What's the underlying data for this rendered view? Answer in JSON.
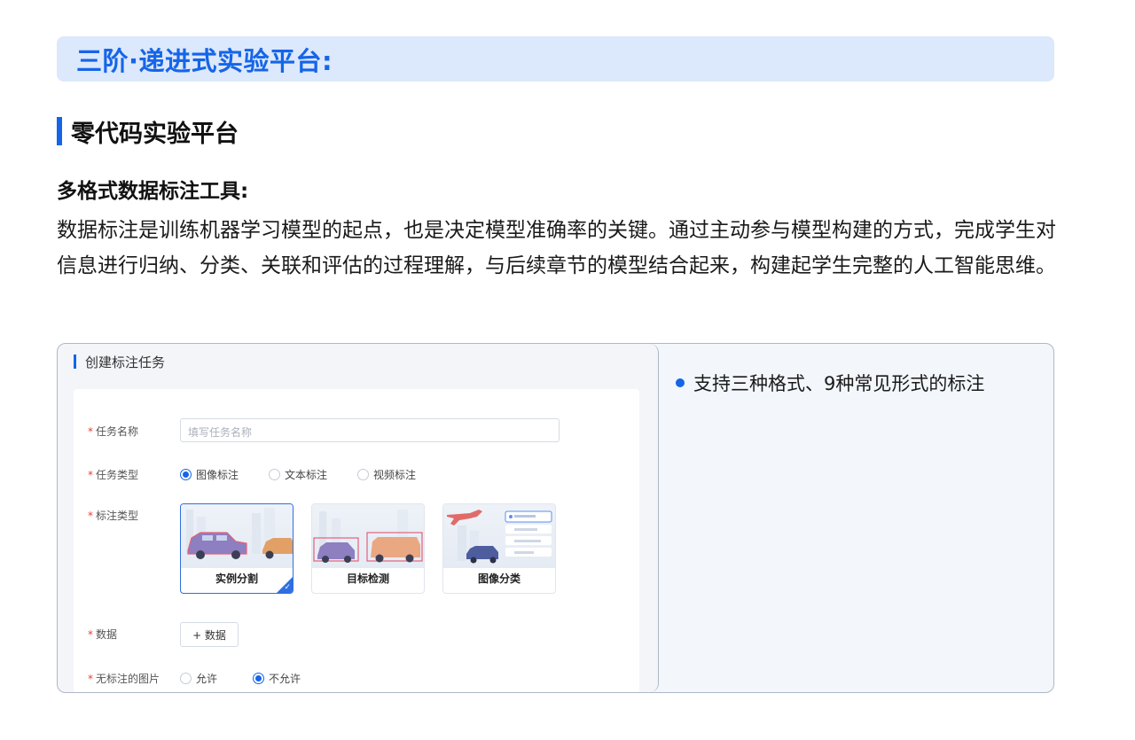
{
  "banner": {
    "title": "三阶·递进式实验平台:"
  },
  "section": {
    "title": "零代码实验平台"
  },
  "feature": {
    "title": "多格式数据标注工具:",
    "description": "数据标注是训练机器学习模型的起点，也是决定模型准确率的关键。通过主动参与模型构建的方式，完成学生对信息进行归纳、分类、关联和评估的过程理解，与后续章节的模型结合起来，构建起学生完整的人工智能思维。"
  },
  "form": {
    "heading": "创建标注任务",
    "required_mark": "*",
    "task_name": {
      "label": "任务名称",
      "placeholder": "填写任务名称"
    },
    "task_type": {
      "label": "任务类型",
      "options": [
        {
          "label": "图像标注",
          "selected": true
        },
        {
          "label": "文本标注",
          "selected": false
        },
        {
          "label": "视频标注",
          "selected": false
        }
      ]
    },
    "annotation_type": {
      "label": "标注类型",
      "cards": [
        {
          "label": "实例分割",
          "selected": true
        },
        {
          "label": "目标检测",
          "selected": false
        },
        {
          "label": "图像分类",
          "selected": false
        }
      ]
    },
    "data": {
      "label": "数据",
      "button": "+ 数据"
    },
    "unlabeled": {
      "label": "无标注的图片",
      "options": [
        {
          "label": "允许",
          "selected": false
        },
        {
          "label": "不允许",
          "selected": true
        }
      ]
    }
  },
  "bullets": [
    "支持三种格式、9种常见形式的标注"
  ],
  "colors": {
    "accent": "#1565e8",
    "banner_bg": "#dce8fb",
    "required": "#e0453a"
  }
}
